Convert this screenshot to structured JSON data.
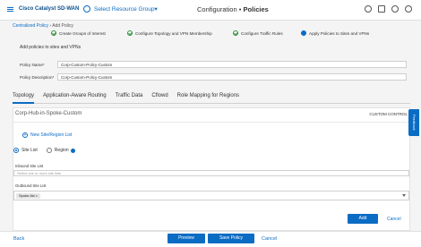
{
  "header": {
    "brand": "Cisco Catalyst SD-WAN",
    "resource_group": "Select Resource Group▾",
    "title_prefix": "Configuration",
    "title_sep": "•",
    "title_main": "Policies"
  },
  "breadcrumb": {
    "parent": "Centralized Policy",
    "sep": "›",
    "current": "Add Policy"
  },
  "steps": [
    {
      "label": "Create Groups of Interest",
      "state": "done"
    },
    {
      "label": "Configure Topology and VPN Membership",
      "state": "done"
    },
    {
      "label": "Configure Traffic Rules",
      "state": "done"
    },
    {
      "label": "Apply Policies to Sites and VPNs",
      "state": "active"
    }
  ],
  "form": {
    "section": "Add policies to sites and VPNs",
    "name_label": "Policy Name*",
    "name_value": "Corp-Custom-Policy-Custom",
    "desc_label": "Policy Description*",
    "desc_value": "Corp-Custom-Policy-Custom"
  },
  "tabs": [
    "Topology",
    "Application-Aware Routing",
    "Traffic Data",
    "Cflowd",
    "Role Mapping for Regions"
  ],
  "panel": {
    "title": "Corp-Hub-in-Spoke-Custom",
    "custom_control": "CUSTOM CONTROL",
    "new_list": "New Site/Region List",
    "radio_site": "Site List",
    "radio_region": "Region",
    "inbound_label": "Inbound Site List",
    "inbound_placeholder": "Select one or more site lists",
    "outbound_label": "Outbound Site List",
    "outbound_tag": "Spoke-list ×"
  },
  "actions": {
    "add": "Add",
    "cancel": "Cancel"
  },
  "feedback": "Feedback",
  "footer": {
    "back": "Back",
    "preview": "Preview",
    "save": "Save Policy",
    "cancel": "Cancel"
  },
  "colors": {
    "accent": "#0b6cc4",
    "done": "#2f8f3b"
  }
}
